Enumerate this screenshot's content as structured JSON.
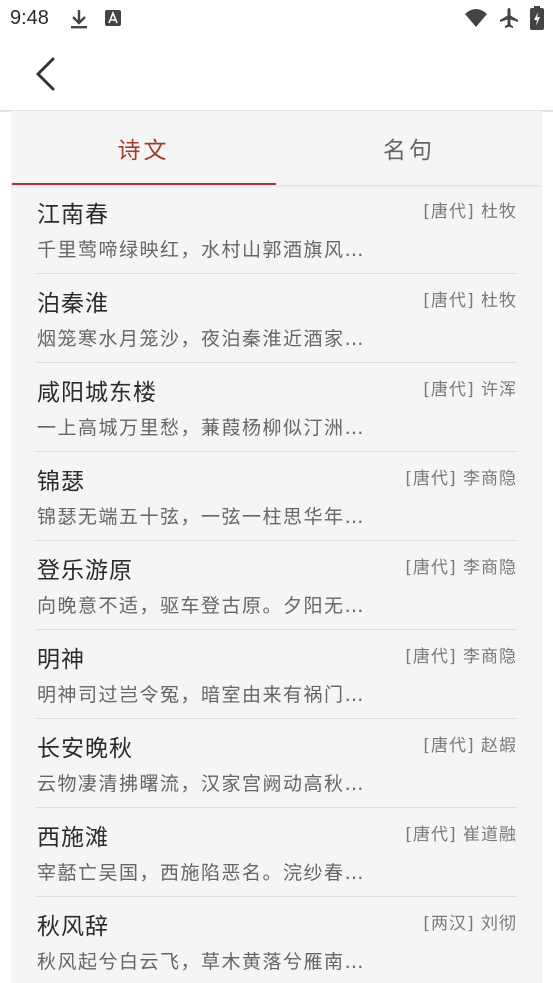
{
  "status_bar": {
    "time": "9:48",
    "icons_left": [
      "download-icon",
      "text-a-icon"
    ],
    "icons_right": [
      "wifi-icon",
      "airplane-icon",
      "battery-charging-icon"
    ]
  },
  "app_bar": {
    "back_icon": "chevron-left-icon"
  },
  "tabs": [
    {
      "label": "诗文",
      "active": true
    },
    {
      "label": "名句",
      "active": false
    }
  ],
  "colors": {
    "accent": "#a33a2c",
    "list_background": "#f5f5f5",
    "divider": "#dcdcdc"
  },
  "poems": [
    {
      "title": "江南春",
      "author": "[唐代] 杜牧",
      "excerpt": "千里莺啼绿映红，水村山郭酒旗风…"
    },
    {
      "title": "泊秦淮",
      "author": "[唐代] 杜牧",
      "excerpt": "烟笼寒水月笼沙，夜泊秦淮近酒家…"
    },
    {
      "title": "咸阳城东楼",
      "author": "[唐代] 许浑",
      "excerpt": "一上高城万里愁，蒹葭杨柳似汀洲…"
    },
    {
      "title": "锦瑟",
      "author": "[唐代] 李商隐",
      "excerpt": "锦瑟无端五十弦，一弦一柱思华年…"
    },
    {
      "title": "登乐游原",
      "author": "[唐代] 李商隐",
      "excerpt": "向晚意不适，驱车登古原。夕阳无…"
    },
    {
      "title": "明神",
      "author": "[唐代] 李商隐",
      "excerpt": "明神司过岂令冤，暗室由来有祸门…"
    },
    {
      "title": "长安晚秋",
      "author": "[唐代] 赵嘏",
      "excerpt": "云物凄清拂曙流，汉家宫阙动高秋…"
    },
    {
      "title": "西施滩",
      "author": "[唐代] 崔道融",
      "excerpt": "宰嚭亡吴国，西施陷恶名。浣纱春…"
    },
    {
      "title": "秋风辞",
      "author": "[两汉] 刘彻",
      "excerpt": "秋风起兮白云飞，草木黄落兮雁南…"
    }
  ]
}
